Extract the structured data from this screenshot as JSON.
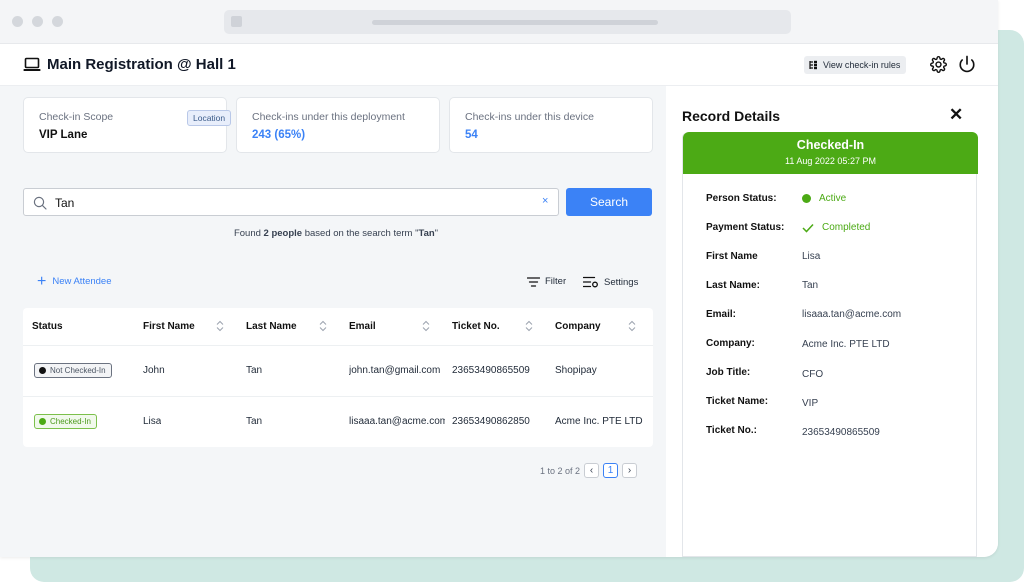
{
  "header": {
    "title": "Main Registration @ Hall 1",
    "view_rules_label": "View check-in rules"
  },
  "stats": {
    "scope": {
      "label": "Check-in Scope",
      "value": "VIP Lane",
      "badge": "Location"
    },
    "deployment": {
      "label": "Check-ins under this deployment",
      "value": "243 (65%)"
    },
    "device": {
      "label": "Check-ins under this device",
      "value": "54"
    }
  },
  "search": {
    "value": "Tan",
    "button_label": "Search",
    "clear_label": "×",
    "result": {
      "prefix": "Found ",
      "count": "2 people",
      "middle": " based on the search term \"",
      "term": "Tan",
      "suffix": "\""
    }
  },
  "toolbar": {
    "new_attendee": "New Attendee",
    "filter": "Filter",
    "settings": "Settings"
  },
  "table": {
    "columns": [
      "Status",
      "First Name",
      "Last Name",
      "Email",
      "Ticket No.",
      "Company"
    ],
    "rows": [
      {
        "status": "Not Checked-In",
        "first_name": "John",
        "last_name": "Tan",
        "email": "john.tan@gmail.com",
        "ticket_no": "23653490865509",
        "company": "Shopipay"
      },
      {
        "status": "Checked-In",
        "first_name": "Lisa",
        "last_name": "Tan",
        "email": "lisaaa.tan@acme.com",
        "ticket_no": "23653490862850",
        "company": "Acme Inc. PTE LTD"
      }
    ]
  },
  "pagination": {
    "summary": "1 to 2 of 2",
    "current_page": "1",
    "prev": "‹",
    "next": "›"
  },
  "record": {
    "panel_title": "Record Details",
    "close": "✕",
    "status_title": "Checked-In",
    "status_time": "11 Aug 2022 05:27 PM",
    "fields": [
      {
        "key": "Person Status:",
        "value": "Active"
      },
      {
        "key": "Payment Status:",
        "value": "Completed"
      },
      {
        "key": "First Name",
        "value": "Lisa"
      },
      {
        "key": "Last Name:",
        "value": "Tan"
      },
      {
        "key": "Email:",
        "value": "lisaaa.tan@acme.com"
      },
      {
        "key": "Company:",
        "value": "Acme Inc. PTE LTD"
      },
      {
        "key": "Job Title:",
        "value": "CFO"
      },
      {
        "key": "Ticket Name:",
        "value": "VIP"
      },
      {
        "key": "Ticket No.:",
        "value": "23653490865509"
      }
    ]
  },
  "colors": {
    "accent": "#3b82f6",
    "success": "#4caa15",
    "background_teal": "#cfe8e3"
  },
  "icons": [
    "laptop-icon",
    "rules-icon",
    "gear-icon",
    "power-icon",
    "search-icon",
    "clear-icon",
    "plus-icon",
    "filter-icon",
    "settings-icon",
    "sort-icon",
    "status-dot-icon",
    "check-icon",
    "close-icon",
    "chevron-left-icon",
    "chevron-right-icon"
  ]
}
